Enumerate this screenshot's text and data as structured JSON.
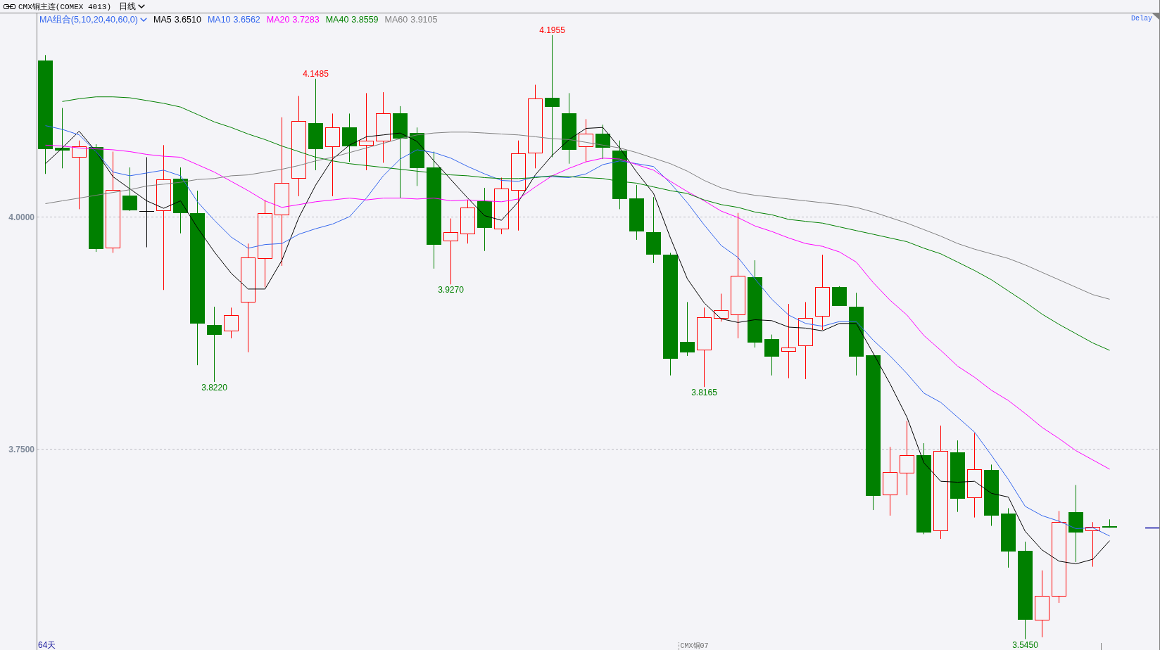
{
  "header": {
    "title": "CMX铜主连(COMEX 4013)",
    "period": "日线"
  },
  "chart": {
    "legend": {
      "selector": "MA组合(5,10,20,40,60,0)",
      "readings": [
        "3.6510",
        "3.6562",
        "3.7283",
        "3.8559",
        "3.9105"
      ]
    },
    "status": "Delay",
    "day_count": "64天",
    "contract_label": "CMX铜07",
    "chart_data": {
      "type": "candlestick",
      "ylim": [
        3.5333,
        4.2189
      ],
      "yticks": [
        {
          "value": 4,
          "label": "4.0000"
        },
        {
          "value": 3.75,
          "label": "3.7500"
        }
      ],
      "ohlc": [
        [
          4.168,
          4.174,
          4.046,
          4.073
        ],
        [
          4.074,
          4.117,
          4.052,
          4.071
        ],
        [
          4.064,
          4.082,
          4.008,
          4.076
        ],
        [
          4.075,
          4.078,
          3.962,
          3.965
        ],
        [
          3.967,
          4.07,
          3.961,
          4.029
        ],
        [
          4.023,
          4.053,
          4.006,
          4.007
        ],
        [
          4.006,
          4.064,
          3.967,
          4.006
        ],
        [
          4.007,
          4.077,
          3.921,
          4.04
        ],
        [
          4.041,
          4.053,
          3.982,
          4.004
        ],
        [
          4.004,
          4.028,
          3.84,
          3.885
        ],
        [
          3.883,
          3.903,
          3.822,
          3.873
        ],
        [
          3.877,
          3.902,
          3.869,
          3.894
        ],
        [
          3.908,
          3.971,
          3.854,
          3.956
        ],
        [
          3.955,
          4.018,
          3.924,
          4.004
        ],
        [
          4.002,
          4.107,
          3.947,
          4.036
        ],
        [
          4.042,
          4.13,
          4.022,
          4.103
        ],
        [
          4.101,
          4.1485,
          4.05,
          4.073
        ],
        [
          4.076,
          4.111,
          4.022,
          4.096
        ],
        [
          4.096,
          4.111,
          4.059,
          4.076
        ],
        [
          4.077,
          4.133,
          4.05,
          4.082
        ],
        [
          4.082,
          4.134,
          4.058,
          4.111
        ],
        [
          4.111,
          4.119,
          4.02,
          4.084
        ],
        [
          4.09,
          4.096,
          4.033,
          4.052
        ],
        [
          4.053,
          4.07,
          3.944,
          3.97
        ],
        [
          3.974,
          3.998,
          3.927,
          3.983
        ],
        [
          3.982,
          4.018,
          3.971,
          4.01
        ],
        [
          4.017,
          4.031,
          3.963,
          3.988
        ],
        [
          3.987,
          4.042,
          3.981,
          4.03
        ],
        [
          4.029,
          4.082,
          3.985,
          4.068
        ],
        [
          4.069,
          4.142,
          4.052,
          4.127
        ],
        [
          4.128,
          4.1955,
          4.064,
          4.118
        ],
        [
          4.111,
          4.133,
          4.057,
          4.072
        ],
        [
          4.076,
          4.105,
          4.059,
          4.089
        ],
        [
          4.089,
          4.099,
          4.062,
          4.074
        ],
        [
          4.071,
          4.082,
          4.008,
          4.019
        ],
        [
          4.02,
          4.034,
          3.975,
          3.984
        ],
        [
          3.983,
          4.021,
          3.95,
          3.959
        ],
        [
          3.959,
          3.961,
          3.829,
          3.847
        ],
        [
          3.865,
          3.908,
          3.85,
          3.854
        ],
        [
          3.857,
          3.902,
          3.8165,
          3.892
        ],
        [
          3.891,
          3.917,
          3.887,
          3.899
        ],
        [
          3.895,
          4.004,
          3.869,
          3.936
        ],
        [
          3.935,
          3.953,
          3.859,
          3.864
        ],
        [
          3.868,
          3.873,
          3.829,
          3.849
        ],
        [
          3.855,
          3.906,
          3.826,
          3.859
        ],
        [
          3.861,
          3.908,
          3.825,
          3.891
        ],
        [
          3.893,
          3.959,
          3.878,
          3.924
        ],
        [
          3.924,
          3.925,
          3.904,
          3.904
        ],
        [
          3.903,
          3.918,
          3.829,
          3.849
        ],
        [
          3.851,
          3.851,
          3.684,
          3.699
        ],
        [
          3.701,
          3.752,
          3.678,
          3.725
        ],
        [
          3.724,
          3.78,
          3.7,
          3.743
        ],
        [
          3.743,
          3.756,
          3.658,
          3.66
        ],
        [
          3.662,
          3.775,
          3.653,
          3.748
        ],
        [
          3.746,
          3.759,
          3.682,
          3.696
        ],
        [
          3.698,
          3.767,
          3.676,
          3.728
        ],
        [
          3.727,
          3.733,
          3.667,
          3.678
        ],
        [
          3.68,
          3.686,
          3.622,
          3.639
        ],
        [
          3.64,
          3.65,
          3.545,
          3.566
        ],
        [
          3.566,
          3.619,
          3.547,
          3.592
        ],
        [
          3.592,
          3.683,
          3.584,
          3.671
        ],
        [
          3.682,
          3.711,
          3.628,
          3.66
        ],
        [
          3.662,
          3.671,
          3.623,
          3.666
        ],
        [
          3.667,
          3.674,
          3.665,
          3.665
        ]
      ],
      "series": [
        {
          "name": "MA5",
          "type": "line",
          "color": "#000000",
          "values": [
            4.057,
            4.074,
            4.092,
            4.07,
            4.043,
            4.03,
            4.017,
            4.009,
            4.017,
            3.988,
            3.962,
            3.939,
            3.922,
            3.922,
            3.953,
            3.999,
            4.034,
            4.062,
            4.077,
            4.086,
            4.088,
            4.09,
            4.081,
            4.06,
            4.04,
            4.02,
            4.001,
            3.996,
            4.016,
            4.045,
            4.066,
            4.083,
            4.095,
            4.096,
            4.074,
            4.048,
            4.025,
            3.977,
            3.933,
            3.907,
            3.89,
            3.886,
            3.889,
            3.888,
            3.881,
            3.88,
            3.877,
            3.885,
            3.885,
            3.853,
            3.82,
            3.784,
            3.735,
            3.715,
            3.714,
            3.715,
            3.702,
            3.698,
            3.661,
            3.641,
            3.629,
            3.626,
            3.631,
            3.651
          ]
        },
        {
          "name": "MA10",
          "type": "line",
          "color": "#3366ee",
          "values": [
            4.098,
            4.094,
            4.088,
            4.07,
            4.048,
            4.044,
            4.047,
            4.05,
            4.044,
            4.016,
            3.996,
            3.978,
            3.966,
            3.97,
            3.971,
            3.981,
            3.987,
            3.992,
            4.0,
            4.02,
            4.044,
            4.062,
            4.072,
            4.069,
            4.063,
            4.054,
            4.046,
            4.039,
            4.038,
            4.043,
            4.043,
            4.042,
            4.046,
            4.056,
            4.06,
            4.057,
            4.054,
            4.036,
            4.015,
            3.991,
            3.969,
            3.956,
            3.933,
            3.911,
            3.894,
            3.885,
            3.882,
            3.887,
            3.887,
            3.867,
            3.85,
            3.831,
            3.81,
            3.8,
            3.784,
            3.768,
            3.743,
            3.717,
            3.688,
            3.678,
            3.672,
            3.664,
            3.665,
            3.656
          ]
        },
        {
          "name": "MA20",
          "type": "line",
          "color": "#ff00ff",
          "values": [
            4.077,
            4.076,
            4.074,
            4.073,
            4.072,
            4.07,
            4.067,
            4.065,
            4.064,
            4.056,
            4.048,
            4.038,
            4.028,
            4.017,
            4.01,
            4.013,
            4.016,
            4.018,
            4.02,
            4.018,
            4.02,
            4.02,
            4.019,
            4.02,
            4.017,
            4.018,
            4.017,
            4.016,
            4.019,
            4.032,
            4.044,
            4.052,
            4.059,
            4.063,
            4.062,
            4.056,
            4.05,
            4.038,
            4.027,
            4.017,
            4.006,
            3.999,
            3.99,
            3.984,
            3.977,
            3.971,
            3.968,
            3.962,
            3.951,
            3.929,
            3.91,
            3.894,
            3.872,
            3.856,
            3.839,
            3.827,
            3.813,
            3.802,
            3.788,
            3.773,
            3.761,
            3.748,
            3.738,
            3.728
          ]
        },
        {
          "name": "MA40",
          "type": "line",
          "color": "#008000",
          "values": [
            null,
            4.124,
            4.127,
            4.129,
            4.129,
            4.128,
            4.125,
            4.122,
            4.118,
            4.11,
            4.102,
            4.096,
            4.089,
            4.083,
            4.076,
            4.07,
            4.064,
            4.06,
            4.057,
            4.055,
            4.053,
            4.051,
            4.049,
            4.047,
            4.045,
            4.044,
            4.042,
            4.041,
            4.041,
            4.042,
            4.044,
            4.043,
            4.042,
            4.041,
            4.038,
            4.036,
            4.032,
            4.028,
            4.025,
            4.018,
            4.013,
            4.01,
            4.005,
            4.002,
            3.997,
            3.995,
            3.993,
            3.989,
            3.985,
            3.981,
            3.977,
            3.973,
            3.966,
            3.96,
            3.951,
            3.942,
            3.932,
            3.92,
            3.908,
            3.895,
            3.884,
            3.874,
            3.864,
            3.856
          ]
        },
        {
          "name": "MA60",
          "type": "line",
          "color": "#808080",
          "values": [
            4.014,
            4.017,
            4.02,
            4.023,
            4.026,
            4.029,
            4.033,
            4.035,
            4.037,
            4.04,
            4.041,
            4.044,
            4.045,
            4.048,
            4.051,
            4.055,
            4.06,
            4.064,
            4.069,
            4.074,
            4.079,
            4.084,
            4.088,
            4.09,
            4.091,
            4.091,
            4.09,
            4.089,
            4.088,
            4.086,
            4.084,
            4.083,
            4.08,
            4.077,
            4.074,
            4.069,
            4.063,
            4.057,
            4.049,
            4.039,
            4.031,
            4.026,
            4.023,
            4.021,
            4.019,
            4.017,
            4.015,
            4.013,
            4.01,
            4.005,
            3.999,
            3.993,
            3.986,
            3.979,
            3.971,
            3.965,
            3.96,
            3.955,
            3.948,
            3.94,
            3.932,
            3.924,
            3.916,
            3.911
          ]
        }
      ],
      "annotations": [
        {
          "text": "3.8220",
          "y": 3.822
        },
        {
          "text": "4.1485",
          "y": 4.1485
        },
        {
          "text": "3.9270",
          "y": 3.927
        },
        {
          "text": "4.1955",
          "y": 4.1955
        },
        {
          "text": "3.8165",
          "y": 3.8165
        },
        {
          "text": "3.5450",
          "y": 3.545
        }
      ]
    }
  }
}
